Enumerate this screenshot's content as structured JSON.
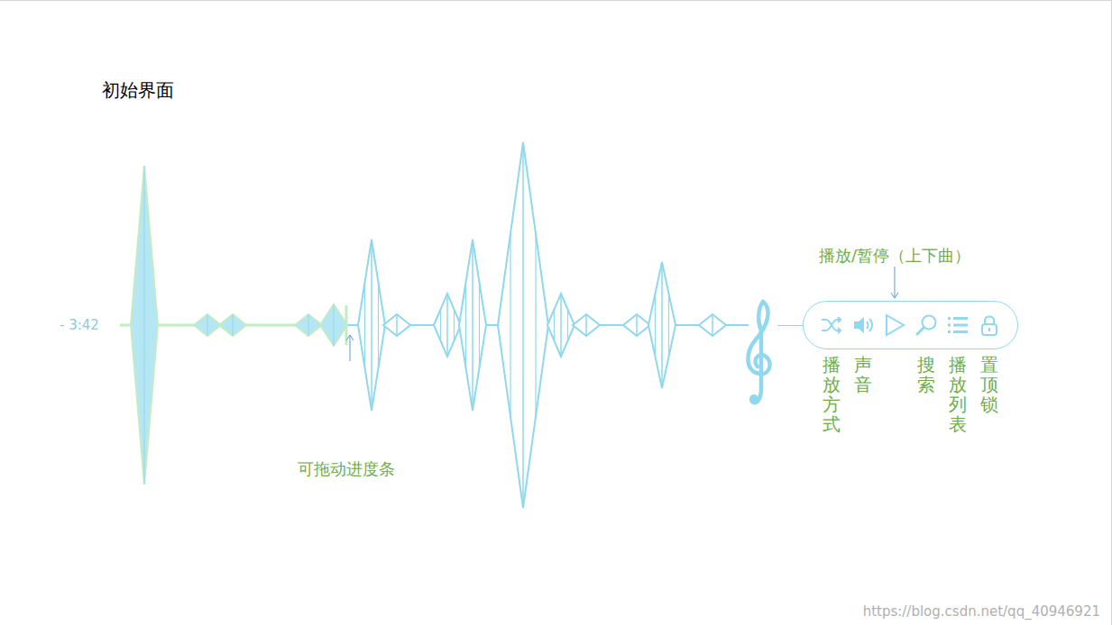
{
  "heading": "初始界面",
  "player": {
    "time": "- 3:42",
    "progress": {
      "level": 0.36,
      "note": "可拖动进度条"
    },
    "waveform": {
      "values": [
        177,
        0,
        0,
        0,
        0,
        12,
        0,
        12,
        0,
        0,
        0,
        0,
        0,
        12,
        0,
        23,
        0,
        0,
        95,
        0,
        12,
        0,
        0,
        0,
        35,
        0,
        95,
        0,
        0,
        0,
        203,
        0,
        0,
        35,
        0,
        12,
        0,
        0,
        0,
        12,
        0,
        70,
        0,
        0,
        0,
        12,
        0,
        0
      ]
    }
  },
  "controls": [
    {
      "kind": "shuffle",
      "label": "播放方式"
    },
    {
      "kind": "volume",
      "label": "声音"
    },
    {
      "kind": "play",
      "label": "",
      "note": "播放/暂停（上下曲）"
    },
    {
      "kind": "search",
      "label": "搜索"
    },
    {
      "kind": "list",
      "label": "播放列表"
    },
    {
      "kind": "lock",
      "label": "置顶锁"
    }
  ],
  "watermark": "https://blog.csdn.net/qq_40946921"
}
